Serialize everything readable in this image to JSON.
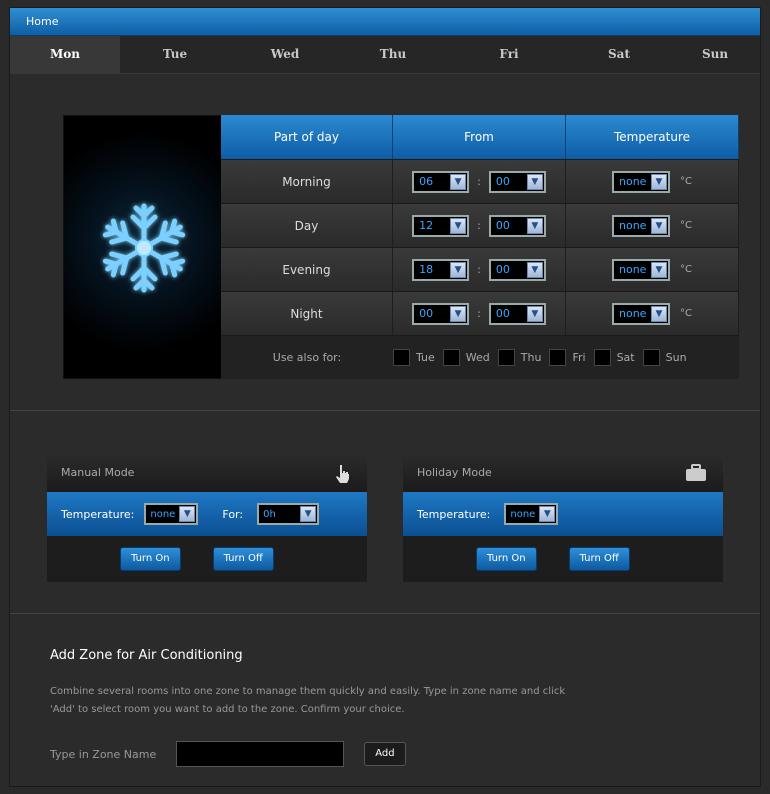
{
  "window": {
    "title": "Home"
  },
  "tabs": [
    {
      "label": "Mon"
    },
    {
      "label": "Tue"
    },
    {
      "label": "Wed"
    },
    {
      "label": "Thu"
    },
    {
      "label": "Fri"
    },
    {
      "label": "Sat"
    },
    {
      "label": "Sun"
    }
  ],
  "schedule": {
    "headers": {
      "part": "Part of day",
      "from": "From",
      "temperature": "Temperature"
    },
    "rows": [
      {
        "part": "Morning",
        "hour": "06",
        "minute": "00",
        "temp": "none",
        "unit": "°C"
      },
      {
        "part": "Day",
        "hour": "12",
        "minute": "00",
        "temp": "none",
        "unit": "°C"
      },
      {
        "part": "Evening",
        "hour": "18",
        "minute": "00",
        "temp": "none",
        "unit": "°C"
      },
      {
        "part": "Night",
        "hour": "00",
        "minute": "00",
        "temp": "none",
        "unit": "°C"
      }
    ],
    "colon": ":",
    "use_also_label": "Use also for:",
    "use_also_days": [
      "Tue",
      "Wed",
      "Thu",
      "Fri",
      "Sat",
      "Sun"
    ]
  },
  "manual_mode": {
    "title": "Manual Mode",
    "temperature_label": "Temperature:",
    "temperature_value": "none",
    "for_label": "For:",
    "for_value": "0h",
    "turn_on": "Turn On",
    "turn_off": "Turn Off"
  },
  "holiday_mode": {
    "title": "Holiday Mode",
    "temperature_label": "Temperature:",
    "temperature_value": "none",
    "turn_on": "Turn On",
    "turn_off": "Turn Off"
  },
  "zone": {
    "heading": "Add Zone for Air Conditioning",
    "description": "Combine several rooms into one zone to manage them quickly and easily. Type in zone name and click 'Add' to select room you want to add to the zone. Confirm your choice.",
    "input_label": "Type in Zone Name",
    "input_value": "",
    "add_button": "Add"
  },
  "colors": {
    "accent": "#1a6fba",
    "background": "#2b2b2b",
    "select_text": "#3aa6ff"
  }
}
